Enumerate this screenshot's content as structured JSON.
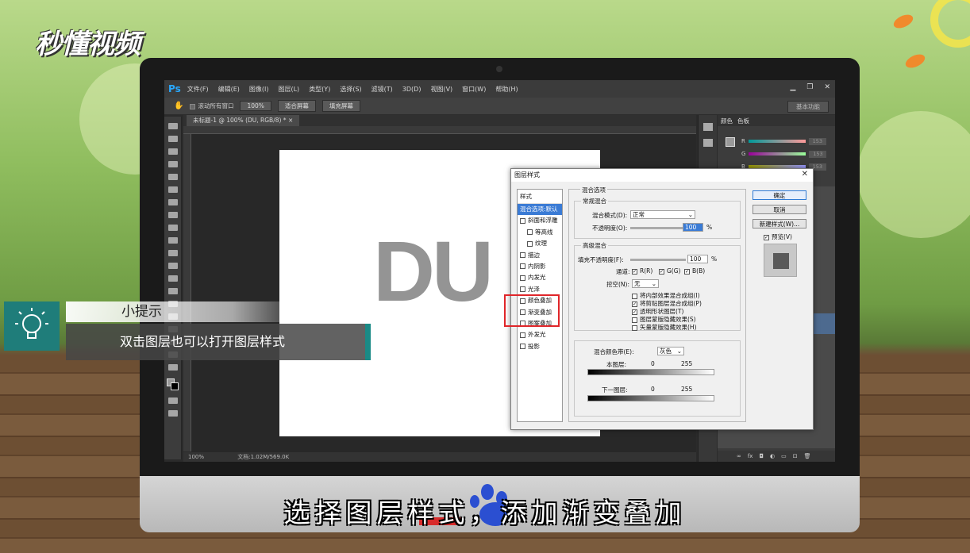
{
  "watermark": {
    "logo_text": "秒懂视频"
  },
  "photoshop": {
    "app_logo": "Ps",
    "menu": [
      "文件(F)",
      "编辑(E)",
      "图像(I)",
      "图层(L)",
      "类型(Y)",
      "选择(S)",
      "滤镜(T)",
      "3D(D)",
      "视图(V)",
      "窗口(W)",
      "帮助(H)"
    ],
    "window_controls": [
      "▁",
      "❐",
      "✕"
    ],
    "options_bar": {
      "scroll_all": "滚动所有窗口",
      "zoom_btn": "100%",
      "fit_screen": "适合屏幕",
      "fill_screen": "填充屏幕",
      "workspace": "基本功能"
    },
    "doc_tab": "未标题-1 @ 100% (DU, RGB/8) *  ×",
    "canvas_text": "DU",
    "status": {
      "zoom": "100%",
      "doc": "文档:1.02M/569.0K"
    },
    "panel_tabs": [
      "颜色",
      "色板"
    ],
    "color_channels": [
      {
        "label": "R",
        "value": "153"
      },
      {
        "label": "G",
        "value": "153"
      },
      {
        "label": "B",
        "value": "153"
      }
    ]
  },
  "dialog": {
    "title": "图层样式",
    "close": "✕",
    "style_header": "样式",
    "styles": [
      {
        "label": "混合选项:默认",
        "checkbox": false,
        "selected": true,
        "sub": false
      },
      {
        "label": "斜面和浮雕",
        "checkbox": true,
        "selected": false,
        "sub": false
      },
      {
        "label": "等高线",
        "checkbox": true,
        "selected": false,
        "sub": true
      },
      {
        "label": "纹理",
        "checkbox": true,
        "selected": false,
        "sub": true
      },
      {
        "label": "描边",
        "checkbox": true,
        "selected": false,
        "sub": false
      },
      {
        "label": "内阴影",
        "checkbox": true,
        "selected": false,
        "sub": false
      },
      {
        "label": "内发光",
        "checkbox": true,
        "selected": false,
        "sub": false
      },
      {
        "label": "光泽",
        "checkbox": true,
        "selected": false,
        "sub": false
      },
      {
        "label": "颜色叠加",
        "checkbox": true,
        "selected": false,
        "sub": false
      },
      {
        "label": "渐变叠加",
        "checkbox": true,
        "selected": false,
        "sub": false
      },
      {
        "label": "图案叠加",
        "checkbox": true,
        "selected": false,
        "sub": false
      },
      {
        "label": "外发光",
        "checkbox": true,
        "selected": false,
        "sub": false
      },
      {
        "label": "投影",
        "checkbox": true,
        "selected": false,
        "sub": false
      }
    ],
    "blend": {
      "section": "混合选项",
      "general": "常规混合",
      "mode_label": "混合模式(D):",
      "mode_value": "正常",
      "opacity_label": "不透明度(O):",
      "opacity_value": "100",
      "percent": "%",
      "advanced": "高级混合",
      "fill_label": "填充不透明度(F):",
      "fill_value": "100",
      "channels_label": "通道:",
      "channels": [
        "R(R)",
        "G(G)",
        "B(B)"
      ],
      "knockout_label": "挖空(N):",
      "knockout_value": "无",
      "options": [
        "将内部效果混合成组(I)",
        "将剪贴图层混合成组(P)",
        "透明形状图层(T)",
        "图层蒙版隐藏效果(S)",
        "矢量蒙版隐藏效果(H)"
      ],
      "options_checked": [
        false,
        true,
        true,
        false,
        false
      ],
      "blend_if_label": "混合颜色带(E):",
      "blend_if_value": "灰色",
      "this_layer": "本图层:",
      "underlying": "下一图层:",
      "low": "0",
      "high": "255"
    },
    "buttons": {
      "ok": "确定",
      "cancel": "取消",
      "new_style": "新建样式(W)...",
      "preview": "预览(V)"
    }
  },
  "tip": {
    "heading": "小提示",
    "body": "双击图层也可以打开图层样式"
  },
  "subtitle": "选择图层样式，添加渐变叠加"
}
